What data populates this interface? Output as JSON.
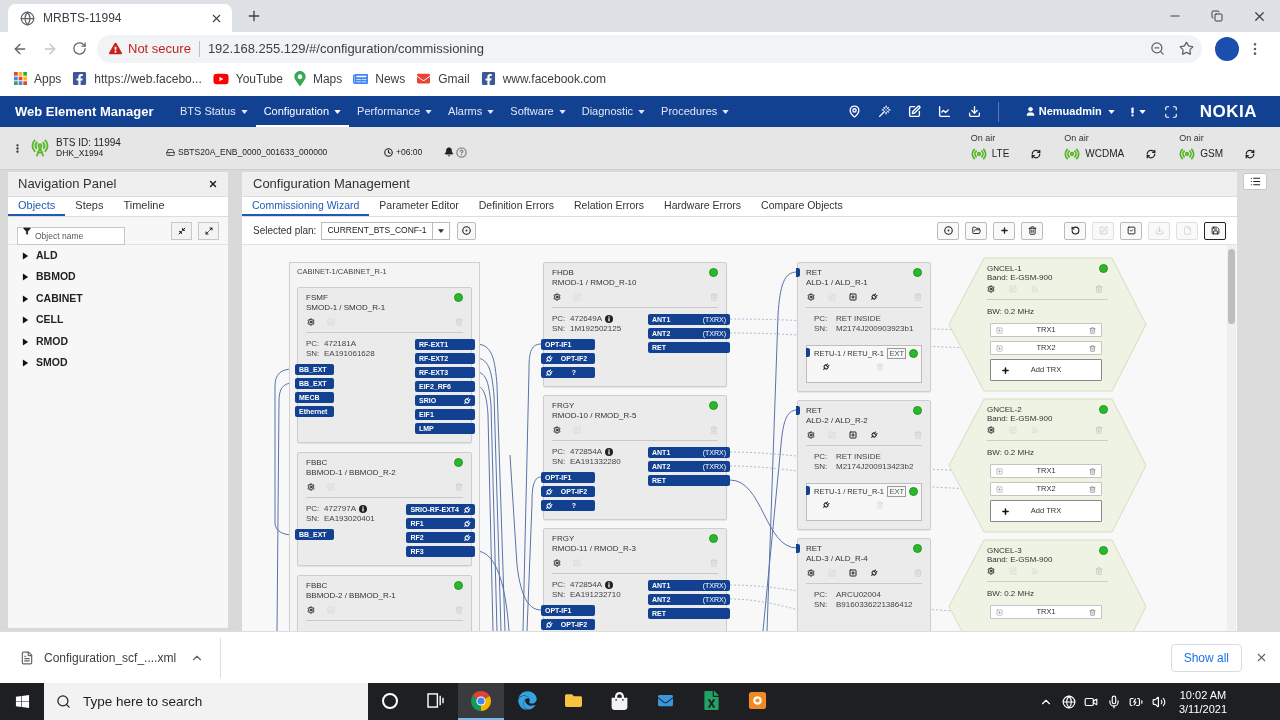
{
  "browser": {
    "tab_title": "MRBTS-11994",
    "security_label": "Not secure",
    "url": "192.168.255.129/#/configuration/commissioning",
    "bookmarks": [
      {
        "kind": "apps",
        "label": "Apps"
      },
      {
        "kind": "facebook",
        "label": "https://web.facebo..."
      },
      {
        "kind": "youtube",
        "label": "YouTube"
      },
      {
        "kind": "maps",
        "label": "Maps"
      },
      {
        "kind": "news",
        "label": "News"
      },
      {
        "kind": "gmail",
        "label": "Gmail"
      },
      {
        "kind": "facebook",
        "label": "www.facebook.com"
      }
    ]
  },
  "header": {
    "title": "Web Element Manager",
    "menu": [
      {
        "label": "BTS Status",
        "selected": false
      },
      {
        "label": "Configuration",
        "selected": true
      },
      {
        "label": "Performance",
        "selected": false
      },
      {
        "label": "Alarms",
        "selected": false
      },
      {
        "label": "Software",
        "selected": false
      },
      {
        "label": "Diagnostic",
        "selected": false
      },
      {
        "label": "Procedures",
        "selected": false
      }
    ],
    "user": "Nemuadmin",
    "brand": "NOKIA"
  },
  "status_bar": {
    "bts_id": "BTS ID: 11994",
    "bts_name": "DHK_X1994",
    "software": "SBTS20A_ENB_0000_001633_000000",
    "time_offset": "+06:00",
    "radios": [
      {
        "state": "On air",
        "tech": "LTE"
      },
      {
        "state": "On air",
        "tech": "WCDMA"
      },
      {
        "state": "On air",
        "tech": "GSM"
      }
    ]
  },
  "navigation_panel": {
    "title": "Navigation Panel",
    "tabs": [
      {
        "label": "Objects",
        "selected": true
      },
      {
        "label": "Steps",
        "selected": false
      },
      {
        "label": "Timeline",
        "selected": false
      }
    ],
    "filter": {
      "placeholder": "Object name"
    },
    "tree": [
      {
        "label": "ALD",
        "expanded": false
      },
      {
        "label": "BBMOD",
        "expanded": false
      },
      {
        "label": "CABINET",
        "expanded": false
      },
      {
        "label": "CELL",
        "expanded": false
      },
      {
        "label": "RMOD",
        "expanded": false
      },
      {
        "label": "SMOD",
        "expanded": false
      }
    ]
  },
  "configuration": {
    "title": "Configuration Management",
    "tabs": [
      {
        "label": "Commissioning Wizard",
        "selected": true
      },
      {
        "label": "Parameter Editor",
        "selected": false
      },
      {
        "label": "Definition Errors",
        "selected": false
      },
      {
        "label": "Relation Errors",
        "selected": false
      },
      {
        "label": "Hardware Errors",
        "selected": false
      },
      {
        "label": "Compare Objects",
        "selected": false
      }
    ],
    "plan_label": "Selected plan:",
    "plan": "CURRENT_BTS_CONF-1",
    "toolbar": [
      {
        "kind": "record",
        "disabled": false,
        "focused": false
      },
      {
        "kind": "open",
        "disabled": false,
        "focused": false
      },
      {
        "kind": "add",
        "disabled": false,
        "focused": false
      },
      {
        "kind": "delete",
        "disabled": false,
        "focused": false
      },
      {
        "kind": "undo",
        "disabled": false,
        "focused": false
      },
      {
        "kind": "edit",
        "disabled": true,
        "focused": false
      },
      {
        "kind": "validate",
        "disabled": false,
        "focused": false
      },
      {
        "kind": "download",
        "disabled": true,
        "focused": false
      },
      {
        "kind": "file",
        "disabled": true,
        "focused": false
      },
      {
        "kind": "save",
        "disabled": false,
        "focused": true
      }
    ]
  },
  "diagram": {
    "cabinet": {
      "title": "CABINET-1/CABINET_R-1",
      "modules": [
        {
          "type": "FSMF",
          "name": "SMOD-1 / SMOD_R-1",
          "pc_label": "PC:",
          "pc": "472181A",
          "info": false,
          "sn_label": "SN:",
          "sn": "EA191061628",
          "left_ports": [
            {
              "label": "BB_EXT",
              "plug": false
            },
            {
              "label": "BB_EXT",
              "plug": false
            },
            {
              "label": "MECB",
              "plug": false
            },
            {
              "label": "Ethernet",
              "plug": false
            }
          ],
          "right_ports": [
            {
              "label": "RF-EXT1",
              "plug": false
            },
            {
              "label": "RF-EXT2",
              "plug": false
            },
            {
              "label": "RF-EXT3",
              "plug": false
            },
            {
              "label": "EIF2_RF6",
              "plug": false
            },
            {
              "label": "SRIO",
              "plug": true
            },
            {
              "label": "EIF1",
              "plug": false
            },
            {
              "label": "LMP",
              "plug": false
            }
          ]
        },
        {
          "type": "FBBC",
          "name": "BBMOD-1 / BBMOD_R-2",
          "pc_label": "PC:",
          "pc": "472797A",
          "info": true,
          "sn_label": "SN:",
          "sn": "EA193020401",
          "left_ports": [
            {
              "label": "BB_EXT",
              "plug": false
            }
          ],
          "right_ports": [
            {
              "label": "SRIO-RF-EXT4",
              "plug": true
            },
            {
              "label": "RF1",
              "plug": true
            },
            {
              "label": "RF2",
              "plug": true
            },
            {
              "label": "RF3",
              "plug": false
            }
          ]
        },
        {
          "type": "FBBC",
          "name": "BBMOD-2 / BBMOD_R-1"
        }
      ]
    },
    "radio_modules": [
      {
        "type": "FHDB",
        "name": "RMOD-1 / RMOD_R-10",
        "pc_label": "PC:",
        "pc": "472649A",
        "info": true,
        "sn_label": "SN:",
        "sn": "1M192502125",
        "left_ports": [
          {
            "label": "OPT-IF1",
            "plug": false
          },
          {
            "label": "OPT-IF2",
            "plug": true
          },
          {
            "label": "?",
            "plug": true
          }
        ],
        "right_ports": [
          {
            "label": "ANT1",
            "tag": "(TXRX)",
            "plug": false
          },
          {
            "label": "ANT2",
            "tag": "(TXRX)",
            "plug": false
          },
          {
            "label": "RET",
            "plug": false
          }
        ]
      },
      {
        "type": "FRGY",
        "name": "RMOD-10 / RMOD_R-5",
        "pc_label": "PC:",
        "pc": "472854A",
        "info": true,
        "sn_label": "SN:",
        "sn": "EA191332280",
        "left_ports": [
          {
            "label": "OPT-IF1",
            "plug": false
          },
          {
            "label": "OPT-IF2",
            "plug": true
          },
          {
            "label": "?",
            "plug": true
          }
        ],
        "right_ports": [
          {
            "label": "ANT1",
            "tag": "(TXRX)",
            "plug": false
          },
          {
            "label": "ANT2",
            "tag": "(TXRX)",
            "plug": false
          },
          {
            "label": "RET",
            "plug": false
          }
        ]
      },
      {
        "type": "FRGY",
        "name": "RMOD-11 / RMOD_R-3",
        "pc_label": "PC:",
        "pc": "472854A",
        "info": true,
        "sn_label": "SN:",
        "sn": "EA191232710",
        "left_ports": [
          {
            "label": "OPT-IF1",
            "plug": false
          },
          {
            "label": "OPT-IF2",
            "plug": true
          }
        ],
        "right_ports": [
          {
            "label": "ANT1",
            "tag": "(TXRX)",
            "plug": false
          },
          {
            "label": "ANT2",
            "tag": "(TXRX)",
            "plug": false
          },
          {
            "label": "RET",
            "plug": false
          }
        ]
      }
    ],
    "antenna_devices": [
      {
        "type": "RET",
        "name": "ALD-1 / ALD_R-1",
        "pc_label": "PC:",
        "pc": "RET INSIDE",
        "sn_label": "SN:",
        "sn": "M2174J200903923b1",
        "unit": {
          "name": "RETU-1 / RETU_R-1",
          "tag": "EXT"
        }
      },
      {
        "type": "RET",
        "name": "ALD-2 / ALD_R-2",
        "pc_label": "PC:",
        "pc": "RET INSIDE",
        "sn_label": "SN:",
        "sn": "M2174J200913423b2",
        "unit": {
          "name": "RETU-1 / RETU_R-1",
          "tag": "EXT"
        }
      },
      {
        "type": "RET",
        "name": "ALD-3 / ALD_R-4",
        "pc_label": "PC:",
        "pc": "ARCU02004",
        "sn_label": "SN:",
        "sn": "B9160336221386412"
      }
    ],
    "cells": [
      {
        "name": "GNCEL-1",
        "band": "Band: E-GSM-900",
        "bw": "BW: 0.2 MHz",
        "trx": [
          {
            "label": "TRX1"
          },
          {
            "label": "TRX2"
          }
        ],
        "add_trx": "Add TRX"
      },
      {
        "name": "GNCEL-2",
        "band": "Band: E-GSM-900",
        "bw": "BW: 0.2 MHz",
        "trx": [
          {
            "label": "TRX1"
          },
          {
            "label": "TRX2"
          }
        ],
        "add_trx": "Add TRX"
      },
      {
        "name": "GNCEL-3",
        "band": "Band: E-GSM-900",
        "bw": "BW: 0.2 MHz",
        "trx": [
          {
            "label": "TRX1"
          }
        ]
      }
    ]
  },
  "downloads": {
    "file": "Configuration_scf_....xml",
    "show_all": "Show all"
  },
  "taskbar": {
    "search_placeholder": "Type here to search",
    "apps": [
      {
        "kind": "cortana",
        "active": false
      },
      {
        "kind": "task-view",
        "active": false
      },
      {
        "kind": "chrome",
        "active": true
      },
      {
        "kind": "edge",
        "active": false
      },
      {
        "kind": "explorer",
        "active": false
      },
      {
        "kind": "store",
        "active": false
      },
      {
        "kind": "mail",
        "active": false
      },
      {
        "kind": "excel",
        "active": false
      },
      {
        "kind": "recorder",
        "active": false
      }
    ],
    "time": "10:02 AM",
    "date": "3/11/2021"
  }
}
